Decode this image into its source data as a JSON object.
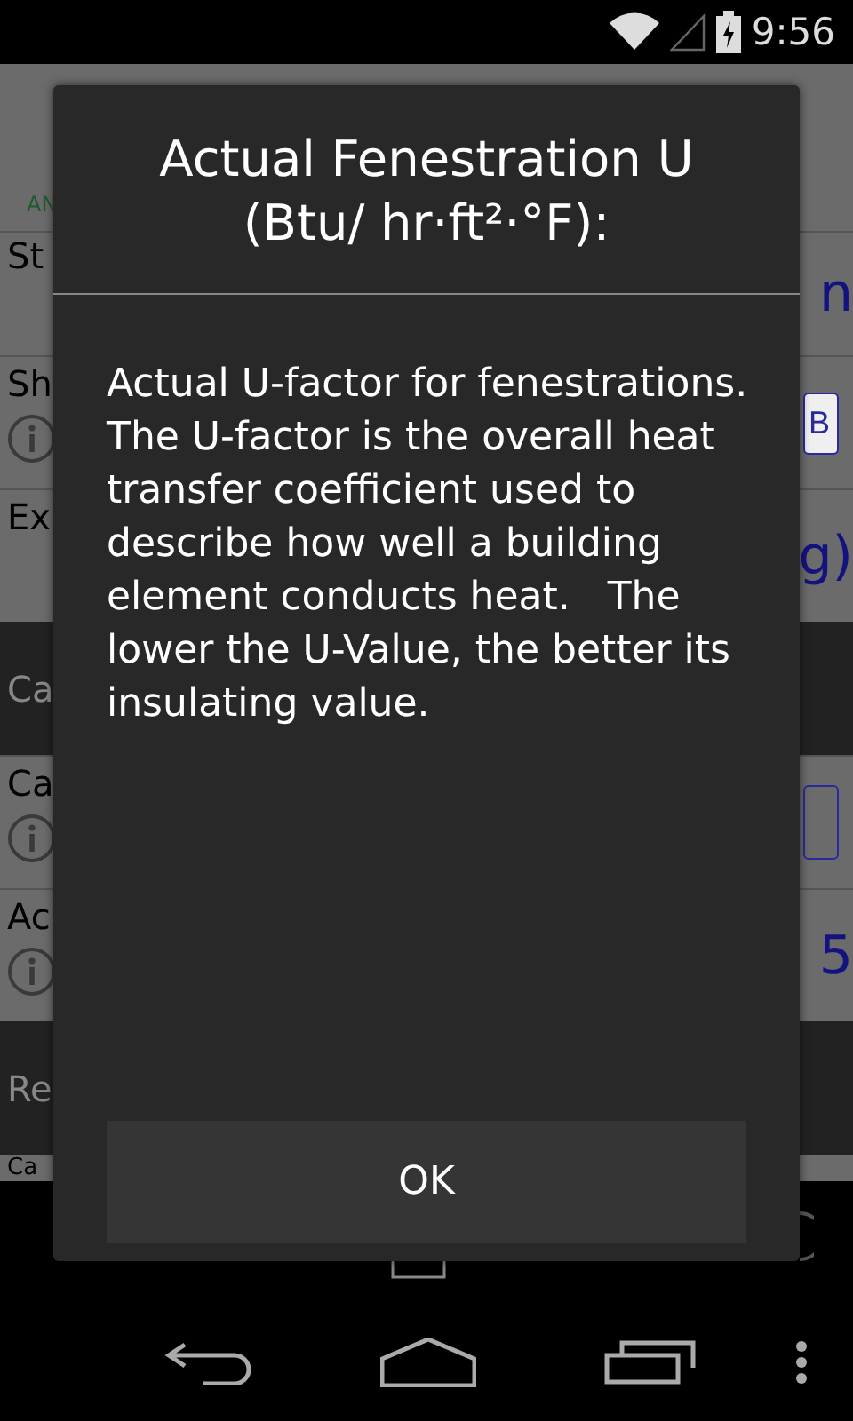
{
  "status_bar": {
    "time": "9:56"
  },
  "background": {
    "header_label": "AN",
    "rows": [
      {
        "kind": "row",
        "left": "St",
        "info": false,
        "right": {
          "kind": "text",
          "text": "n"
        }
      },
      {
        "kind": "row",
        "left": "Sh",
        "info": true,
        "right": {
          "kind": "button",
          "text": "B"
        }
      },
      {
        "kind": "row",
        "left": "Ex",
        "info": false,
        "right": {
          "kind": "text",
          "text": "g)"
        }
      },
      {
        "kind": "section",
        "left": "Ca"
      },
      {
        "kind": "row",
        "left": "Ca",
        "info": true,
        "right": {
          "kind": "field"
        }
      },
      {
        "kind": "row",
        "left": "Ac",
        "info": true,
        "right": {
          "kind": "text",
          "text": "5"
        }
      },
      {
        "kind": "section",
        "left": "Re"
      },
      {
        "kind": "cut",
        "left": "Ca"
      }
    ]
  },
  "dialog": {
    "title": "Actual Fenestration U (Btu/ hr·ft²·°F):",
    "message": "Actual U-factor for fenestrations.  The U-factor is the overall heat transfer coefficient used to describe how well a building element conducts heat.   The lower the U-Value, the better its insulating value.",
    "button": "OK"
  }
}
